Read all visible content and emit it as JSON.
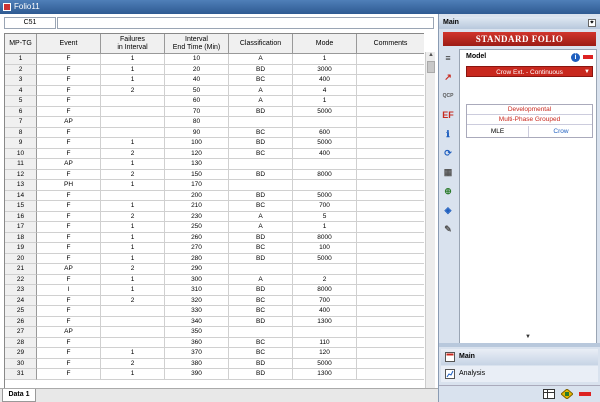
{
  "window": {
    "title": "Folio11"
  },
  "cell_ref": {
    "value": "C51"
  },
  "grid": {
    "columns": [
      "MP-TG",
      "Event",
      "Failures\nin Interval",
      "Interval\nEnd Time (Min)",
      "Classification",
      "Mode",
      "Comments"
    ],
    "rows": [
      [
        "1",
        "F",
        "1",
        "10",
        "A",
        "1",
        ""
      ],
      [
        "2",
        "F",
        "1",
        "20",
        "BD",
        "3000",
        ""
      ],
      [
        "3",
        "F",
        "1",
        "40",
        "BC",
        "400",
        ""
      ],
      [
        "4",
        "F",
        "2",
        "50",
        "A",
        "4",
        ""
      ],
      [
        "5",
        "F",
        "",
        "60",
        "A",
        "1",
        ""
      ],
      [
        "6",
        "F",
        "",
        "70",
        "BD",
        "5000",
        ""
      ],
      [
        "7",
        "AP",
        "",
        "80",
        "",
        "",
        ""
      ],
      [
        "8",
        "F",
        "",
        "90",
        "BC",
        "600",
        ""
      ],
      [
        "9",
        "F",
        "1",
        "100",
        "BD",
        "5000",
        ""
      ],
      [
        "10",
        "F",
        "2",
        "120",
        "BC",
        "400",
        ""
      ],
      [
        "11",
        "AP",
        "1",
        "130",
        "",
        "",
        ""
      ],
      [
        "12",
        "F",
        "2",
        "150",
        "BD",
        "8000",
        ""
      ],
      [
        "13",
        "PH",
        "1",
        "170",
        "",
        "",
        ""
      ],
      [
        "14",
        "F",
        "",
        "200",
        "BD",
        "5000",
        ""
      ],
      [
        "15",
        "F",
        "1",
        "210",
        "BC",
        "700",
        ""
      ],
      [
        "16",
        "F",
        "2",
        "230",
        "A",
        "5",
        ""
      ],
      [
        "17",
        "F",
        "1",
        "250",
        "A",
        "1",
        ""
      ],
      [
        "18",
        "F",
        "1",
        "260",
        "BD",
        "8000",
        ""
      ],
      [
        "19",
        "F",
        "1",
        "270",
        "BC",
        "100",
        ""
      ],
      [
        "20",
        "F",
        "1",
        "280",
        "BD",
        "5000",
        ""
      ],
      [
        "21",
        "AP",
        "2",
        "290",
        "",
        "",
        ""
      ],
      [
        "22",
        "F",
        "1",
        "300",
        "A",
        "2",
        ""
      ],
      [
        "23",
        "I",
        "1",
        "310",
        "BD",
        "8000",
        ""
      ],
      [
        "24",
        "F",
        "2",
        "320",
        "BC",
        "700",
        ""
      ],
      [
        "25",
        "F",
        "",
        "330",
        "BC",
        "400",
        ""
      ],
      [
        "26",
        "F",
        "",
        "340",
        "BD",
        "1300",
        ""
      ],
      [
        "27",
        "AP",
        "",
        "350",
        "",
        "",
        ""
      ],
      [
        "28",
        "F",
        "",
        "360",
        "BC",
        "110",
        ""
      ],
      [
        "29",
        "F",
        "1",
        "370",
        "BC",
        "120",
        ""
      ],
      [
        "30",
        "F",
        "2",
        "380",
        "BD",
        "5000",
        ""
      ],
      [
        "31",
        "F",
        "1",
        "390",
        "BD",
        "1300",
        ""
      ]
    ]
  },
  "sheet_tabs": [
    "Data 1"
  ],
  "panel": {
    "header": "Main",
    "pin_glyph": "⌖",
    "banner": "STANDARD FOLIO",
    "model_label": "Model",
    "info_glyph": "i",
    "model_value": "Crow Ext. - Continuous",
    "dropdown_glyph": "▼",
    "settings": {
      "row1": "Developmental",
      "row2": "Multi-Phase Grouped",
      "method": "MLE",
      "model": "Crow"
    },
    "tools": [
      "≡",
      "↗",
      "QCP",
      "EF",
      "ℹ",
      "⟳",
      "▦",
      "⊕",
      "◈",
      "✎"
    ],
    "collapse_glyph": "▼",
    "nav": {
      "main": "Main",
      "analysis": "Analysis"
    }
  },
  "colors": {
    "accent_red": "#c8281e",
    "link_blue": "#1f5fbf",
    "panel_bg": "#d9e2ee"
  }
}
